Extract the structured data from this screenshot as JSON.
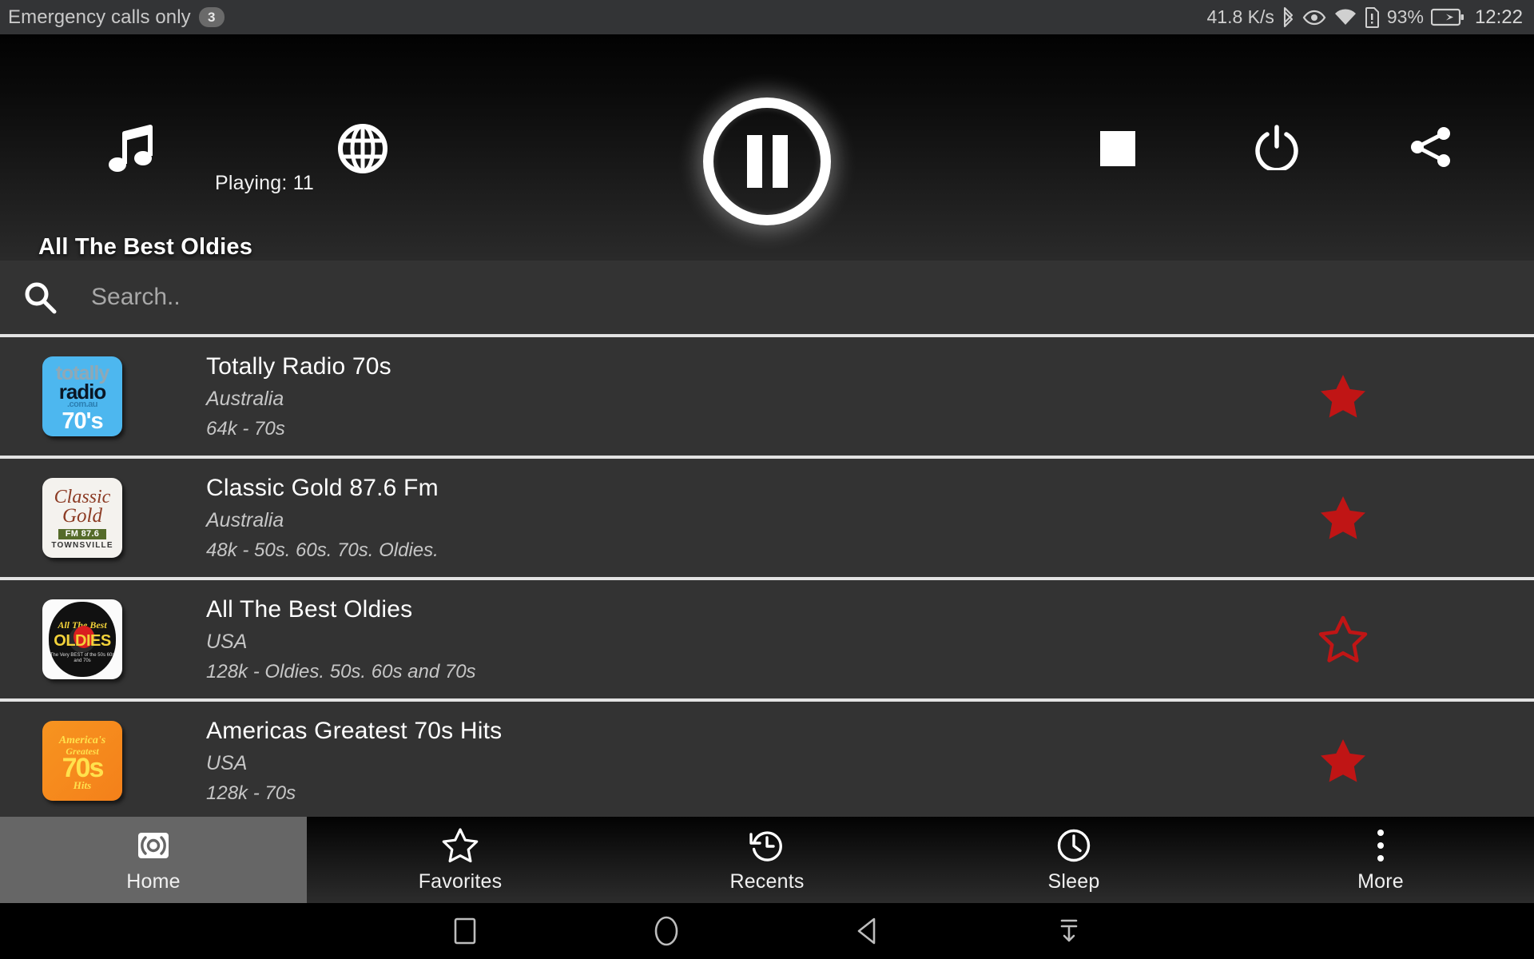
{
  "statusbar": {
    "carrier": "Emergency calls only",
    "notif_count": "3",
    "network_speed": "41.8 K/s",
    "battery_percent": "93%",
    "time": "12:22",
    "icons": [
      "bluetooth-icon",
      "eye-icon",
      "wifi-icon",
      "sim-alert-icon",
      "battery-charging-icon"
    ]
  },
  "player": {
    "music_icon": "music-note-icon",
    "globe_icon": "globe-icon",
    "playing_label": "Playing: 11",
    "pause_icon": "pause-icon",
    "stop_icon": "stop-icon",
    "power_icon": "power-icon",
    "share_icon": "share-icon",
    "station_title": "All The Best Oldies"
  },
  "search": {
    "icon": "search-icon",
    "placeholder": "Search..",
    "value": ""
  },
  "stations": [
    {
      "name": "Totally Radio 70s",
      "country": "Australia",
      "meta": "64k - 70s",
      "favorite": true,
      "logo": {
        "kind": "totally-radio",
        "line1": "totally",
        "line2": "radio",
        "line3": ".com.au",
        "line4": "70's"
      }
    },
    {
      "name": "Classic Gold 87.6 Fm",
      "country": "Australia",
      "meta": "48k - 50s. 60s. 70s. Oldies.",
      "favorite": true,
      "logo": {
        "kind": "classic-gold",
        "line1": "Classic",
        "line2": "Gold",
        "line3": "FM 87.6",
        "line4": "TOWNSVILLE"
      }
    },
    {
      "name": "All The Best Oldies",
      "country": "USA",
      "meta": "128k - Oldies. 50s. 60s and 70s",
      "favorite": false,
      "logo": {
        "kind": "all-the-best-oldies",
        "line1": "All The Best",
        "line2": "OLDIES",
        "line3": "The Very BEST of the 50s 60s and 70s"
      }
    },
    {
      "name": "Americas Greatest 70s Hits",
      "country": "USA",
      "meta": "128k - 70s",
      "favorite": true,
      "logo": {
        "kind": "americas-greatest",
        "line1": "America's",
        "line2": "Greatest",
        "line3": "70s",
        "line4": "Hits"
      }
    }
  ],
  "bottom_nav": [
    {
      "label": "Home",
      "icon": "broadcast-icon",
      "active": true
    },
    {
      "label": "Favorites",
      "icon": "star-outline-icon",
      "active": false
    },
    {
      "label": "Recents",
      "icon": "history-icon",
      "active": false
    },
    {
      "label": "Sleep",
      "icon": "clock-icon",
      "active": false
    },
    {
      "label": "More",
      "icon": "overflow-dots-icon",
      "active": false
    }
  ],
  "android_nav": [
    {
      "icon": "square-recents-icon"
    },
    {
      "icon": "circle-home-icon"
    },
    {
      "icon": "triangle-back-icon"
    },
    {
      "icon": "hide-navbar-icon"
    }
  ],
  "colors": {
    "favorite_star": "#c01515",
    "list_background": "#333333",
    "divider": "#e3e3e3",
    "active_tab": "#666666"
  }
}
